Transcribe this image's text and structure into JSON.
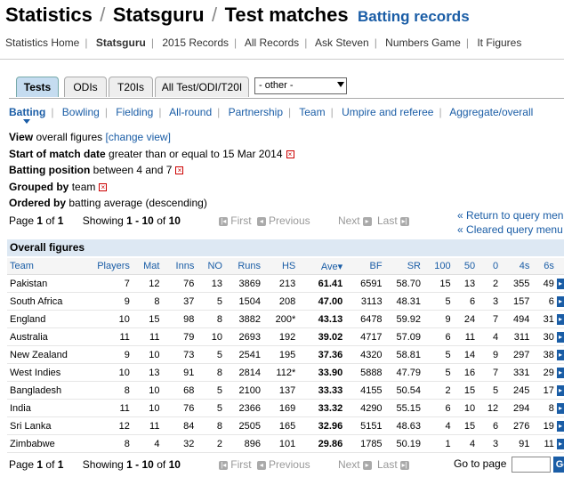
{
  "title": {
    "part1": "Statistics",
    "sep1": "/",
    "part2": "Statsguru",
    "sep2": "/",
    "part3": "Test matches",
    "sub": "Batting records"
  },
  "subnav": [
    "Statistics Home",
    "Statsguru",
    "2015 Records",
    "All Records",
    "Ask Steven",
    "Numbers Game",
    "It Figures"
  ],
  "tabs": [
    "Tests",
    "ODIs",
    "T20Is",
    "All Test/ODI/T20I"
  ],
  "other_select": "- other -",
  "views": [
    "Batting",
    "Bowling",
    "Fielding",
    "All-round",
    "Partnership",
    "Team",
    "Umpire and referee",
    "Aggregate/overall"
  ],
  "filters": {
    "view_label": "View",
    "view_text": "overall figures",
    "view_link": "[change view]",
    "date_label": "Start of match date",
    "date_text": "greater than or equal to 15 Mar 2014",
    "pos_label": "Batting position",
    "pos_text": "between 4 and 7",
    "group_label": "Grouped by",
    "group_text": "team",
    "order_label": "Ordered by",
    "order_text": "batting average (descending)"
  },
  "pager": {
    "page_word": "Page",
    "page": "1",
    "of_word": "of",
    "pages": "1",
    "showing_word": "Showing",
    "range": "1 - 10",
    "total": "10",
    "first": "First",
    "previous": "Previous",
    "next": "Next",
    "last": "Last"
  },
  "return_link": "Return to query menu",
  "cleared_link": "Cleared query menu",
  "table_title": "Overall figures",
  "columns": [
    "Team",
    "Players",
    "Mat",
    "Inns",
    "NO",
    "Runs",
    "HS",
    "Ave",
    "BF",
    "SR",
    "100",
    "50",
    "0",
    "4s",
    "6s"
  ],
  "rows": [
    [
      "Pakistan",
      "7",
      "12",
      "76",
      "13",
      "3869",
      "213",
      "61.41",
      "6591",
      "58.70",
      "15",
      "13",
      "2",
      "355",
      "49"
    ],
    [
      "South Africa",
      "9",
      "8",
      "37",
      "5",
      "1504",
      "208",
      "47.00",
      "3113",
      "48.31",
      "5",
      "6",
      "3",
      "157",
      "6"
    ],
    [
      "England",
      "10",
      "15",
      "98",
      "8",
      "3882",
      "200*",
      "43.13",
      "6478",
      "59.92",
      "9",
      "24",
      "7",
      "494",
      "31"
    ],
    [
      "Australia",
      "11",
      "11",
      "79",
      "10",
      "2693",
      "192",
      "39.02",
      "4717",
      "57.09",
      "6",
      "11",
      "4",
      "311",
      "30"
    ],
    [
      "New Zealand",
      "9",
      "10",
      "73",
      "5",
      "2541",
      "195",
      "37.36",
      "4320",
      "58.81",
      "5",
      "14",
      "9",
      "297",
      "38"
    ],
    [
      "West Indies",
      "10",
      "13",
      "91",
      "8",
      "2814",
      "112*",
      "33.90",
      "5888",
      "47.79",
      "5",
      "16",
      "7",
      "331",
      "29"
    ],
    [
      "Bangladesh",
      "8",
      "10",
      "68",
      "5",
      "2100",
      "137",
      "33.33",
      "4155",
      "50.54",
      "2",
      "15",
      "5",
      "245",
      "17"
    ],
    [
      "India",
      "11",
      "10",
      "76",
      "5",
      "2366",
      "169",
      "33.32",
      "4290",
      "55.15",
      "6",
      "10",
      "12",
      "294",
      "8"
    ],
    [
      "Sri Lanka",
      "12",
      "11",
      "84",
      "8",
      "2505",
      "165",
      "32.96",
      "5151",
      "48.63",
      "4",
      "15",
      "6",
      "276",
      "19"
    ],
    [
      "Zimbabwe",
      "8",
      "4",
      "32",
      "2",
      "896",
      "101",
      "29.86",
      "1785",
      "50.19",
      "1",
      "4",
      "3",
      "91",
      "11"
    ]
  ],
  "goto_label": "Go to page",
  "go_button": "Go"
}
